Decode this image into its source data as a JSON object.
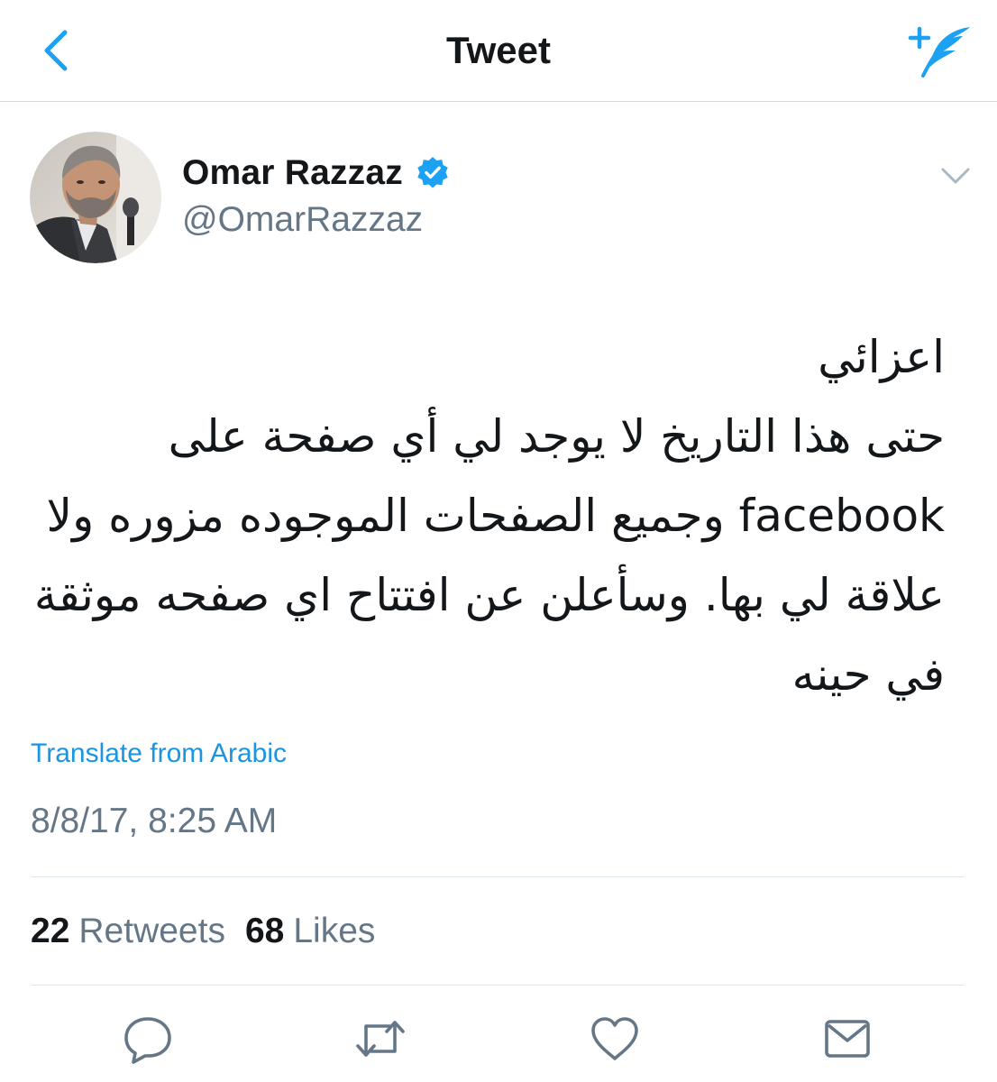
{
  "colors": {
    "accent": "#1da1f2",
    "link": "#1b95e0",
    "text_primary": "#14171a",
    "text_secondary": "#657786",
    "divider": "#e1e8ed",
    "icon_gray": "#657786"
  },
  "navbar": {
    "title": "Tweet",
    "back_icon": "chevron-left-icon",
    "compose_icon": "compose-tweet-icon"
  },
  "author": {
    "name": "Omar Razzaz",
    "handle": "@OmarRazzaz",
    "verified": true,
    "avatar_icon": "profile-photo",
    "menu_icon": "chevron-down-icon"
  },
  "tweet": {
    "lines": [
      "اعزائي",
      "حتى هذا التاريخ لا يوجد لي أي صفحة على",
      "facebook وجميع الصفحات الموجوده مزوره ولا",
      "علاقة لي بها. وسأعلن عن افتتاح اي صفحه موثقة",
      "في حينه"
    ],
    "translate_label": "Translate from Arabic",
    "timestamp": "8/8/17, 8:25 AM"
  },
  "stats": {
    "retweets_count": "22",
    "retweets_label": "Retweets",
    "likes_count": "68",
    "likes_label": "Likes"
  },
  "actions": [
    {
      "icon": "reply-icon"
    },
    {
      "icon": "retweet-icon"
    },
    {
      "icon": "like-heart-icon"
    },
    {
      "icon": "direct-message-icon"
    }
  ]
}
